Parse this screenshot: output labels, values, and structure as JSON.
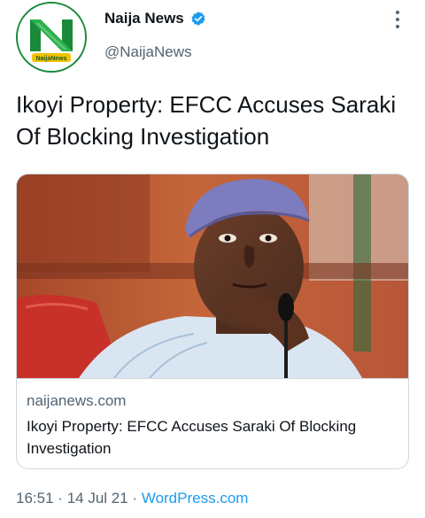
{
  "account": {
    "display_name": "Naija News",
    "handle": "@NaijaNews",
    "avatar_text": "NaijaNews"
  },
  "tweet": {
    "text": "Ikoyi Property: EFCC Accuses Saraki Of Blocking Investigation"
  },
  "card": {
    "domain": "naijanews.com",
    "title": "Ikoyi Property: EFCC Accuses Saraki Of Blocking Investigation"
  },
  "meta": {
    "time": "16:51",
    "separator": "·",
    "date": "14 Jul 21",
    "source": "WordPress.com"
  },
  "colors": {
    "verified": "#1d9bf0",
    "link": "#1d9bf0",
    "brand_green": "#1a8a3a"
  },
  "icons": [
    "verified-badge-icon",
    "more-options-icon"
  ]
}
